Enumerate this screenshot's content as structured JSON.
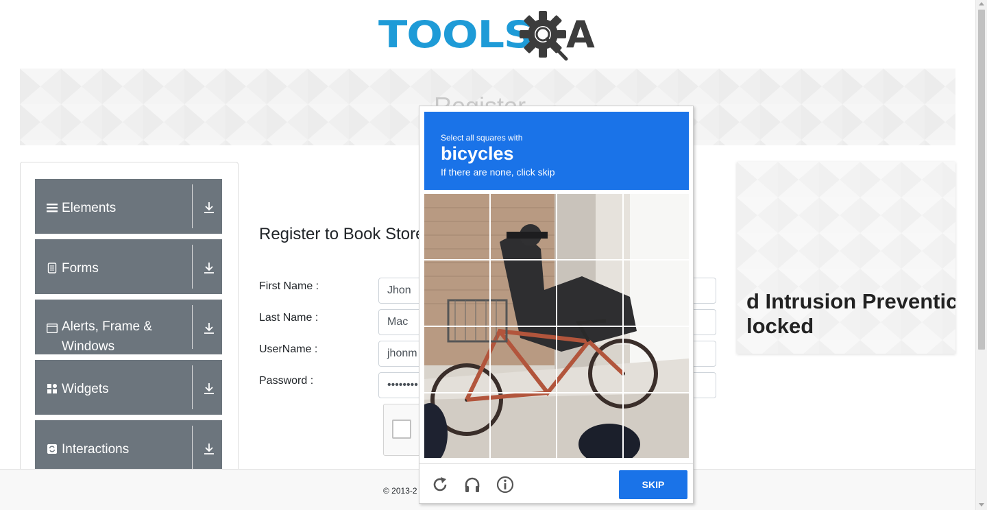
{
  "logo": {
    "text": "TOOLS",
    "suffix": "A"
  },
  "banner": {
    "title": "Register"
  },
  "sidebar": {
    "items": [
      {
        "label": "Elements",
        "icon": "hamburger-icon"
      },
      {
        "label": "Forms",
        "icon": "document-icon"
      },
      {
        "label": "Alerts, Frame & Windows",
        "icon": "window-icon"
      },
      {
        "label": "Widgets",
        "icon": "widgets-icon"
      },
      {
        "label": "Interactions",
        "icon": "interactions-icon"
      }
    ]
  },
  "form": {
    "title": "Register to Book Store",
    "fields": [
      {
        "label": "First Name :",
        "value": "Jhon"
      },
      {
        "label": "Last Name :",
        "value": "Mac"
      },
      {
        "label": "UserName :",
        "value": "jhonm"
      },
      {
        "label": "Password :",
        "value": "••••••••"
      }
    ]
  },
  "ad": {
    "text": "d Intrusion Preventic\nlocked"
  },
  "footer": {
    "text": "© 2013-2"
  },
  "captcha": {
    "instruction": "Select all squares with",
    "object": "bicycles",
    "hint": "If there are none, click skip",
    "skip_label": "SKIP",
    "colors": {
      "accent": "#1a73e8"
    }
  }
}
